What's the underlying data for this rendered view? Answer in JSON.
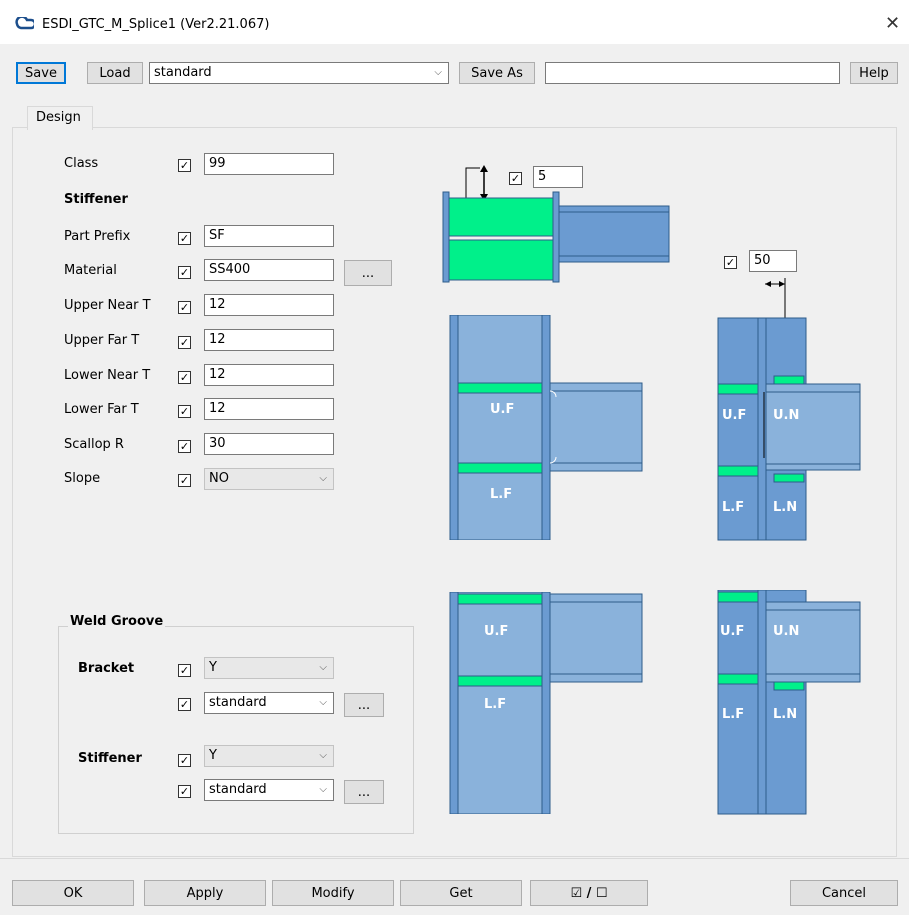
{
  "window": {
    "title": "ESDI_GTC_M_Splice1 (Ver2.21.067)",
    "close": "✕"
  },
  "toolbar": {
    "save": "Save",
    "load": "Load",
    "preset": "standard",
    "save_as": "Save As",
    "save_as_name": "",
    "help": "Help"
  },
  "tab": {
    "design": "Design"
  },
  "form": {
    "class_label": "Class",
    "class_value": "99",
    "stiffener_heading": "Stiffener",
    "part_prefix_label": "Part Prefix",
    "part_prefix_value": "SF",
    "material_label": "Material",
    "material_value": "SS400",
    "material_browse": "...",
    "upper_near_label": "Upper Near T",
    "upper_near_value": "12",
    "upper_far_label": "Upper Far T",
    "upper_far_value": "12",
    "lower_near_label": "Lower Near T",
    "lower_near_value": "12",
    "lower_far_label": "Lower Far T",
    "lower_far_value": "12",
    "scallop_label": "Scallop R",
    "scallop_value": "30",
    "slope_label": "Slope",
    "slope_value": "NO"
  },
  "weld": {
    "heading": "Weld Groove",
    "bracket_label": "Bracket",
    "bracket_value": "Y",
    "bracket_std": "standard",
    "bracket_browse": "...",
    "stiffener_label": "Stiffener",
    "stiffener_value": "Y",
    "stiffener_std": "standard",
    "stiffener_browse": "..."
  },
  "diagram": {
    "top_offset": "5",
    "side_offset": "50",
    "uf": "U.F",
    "lf": "L.F",
    "un": "U.N",
    "ln": "L.N",
    "colors": {
      "steel": "#6b9bd1",
      "steel_dark": "#2e5c8a",
      "stiffener": "#00f08a"
    }
  },
  "footer": {
    "ok": "OK",
    "apply": "Apply",
    "modify": "Modify",
    "get": "Get",
    "toggle": "☑ / ☐",
    "cancel": "Cancel"
  }
}
